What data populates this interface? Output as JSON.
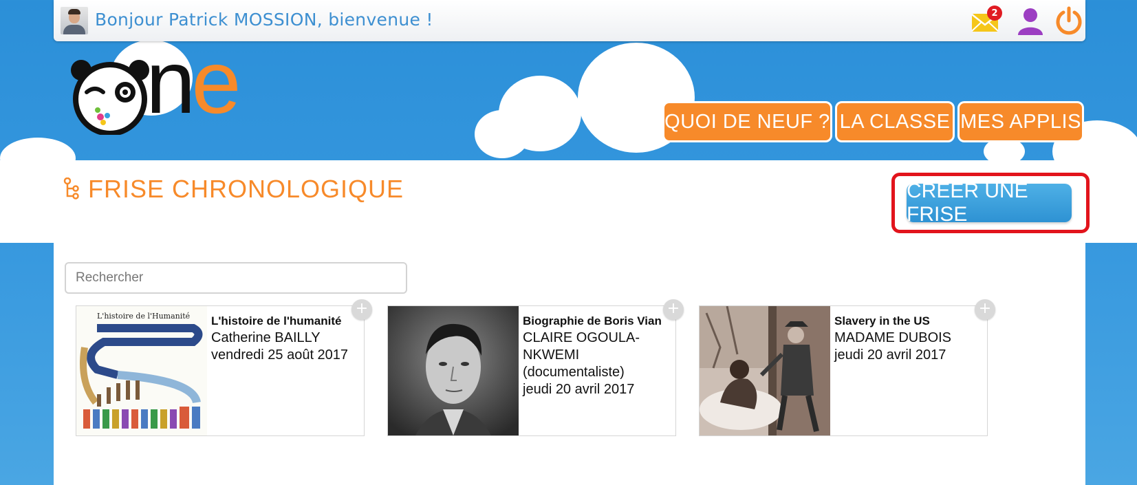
{
  "topbar": {
    "greeting": "Bonjour Patrick MOSSION, bienvenue !",
    "mail_count": "2"
  },
  "logo": {
    "text_n": "n",
    "text_e": "e"
  },
  "nav": {
    "items": [
      {
        "label": "QUOI DE NEUF ?"
      },
      {
        "label": "LA CLASSE"
      },
      {
        "label": "MES APPLIS"
      }
    ]
  },
  "page": {
    "title": "FRISE CHRONOLOGIQUE",
    "create_label": "CRÉER UNE FRISE"
  },
  "search": {
    "placeholder": "Rechercher"
  },
  "cards": [
    {
      "title": "L'histoire de l'humanité",
      "author": "Catherine BAILLY",
      "date": "vendredi 25 août 2017",
      "thumb_caption": "L'histoire de l'Humanité"
    },
    {
      "title": "Biographie de Boris Vian",
      "author": "CLAIRE OGOULA-NKWEMI (documentaliste)",
      "date": "jeudi 20 avril 2017"
    },
    {
      "title": "Slavery in the US",
      "author": "MADAME DUBOIS",
      "date": "jeudi 20 avril 2017"
    }
  ],
  "colors": {
    "orange": "#f78a2a",
    "blue": "#3597de",
    "highlight": "#e2141c"
  },
  "icons": [
    "mail-icon",
    "user-icon",
    "power-icon",
    "timeline-icon",
    "plus-icon"
  ]
}
